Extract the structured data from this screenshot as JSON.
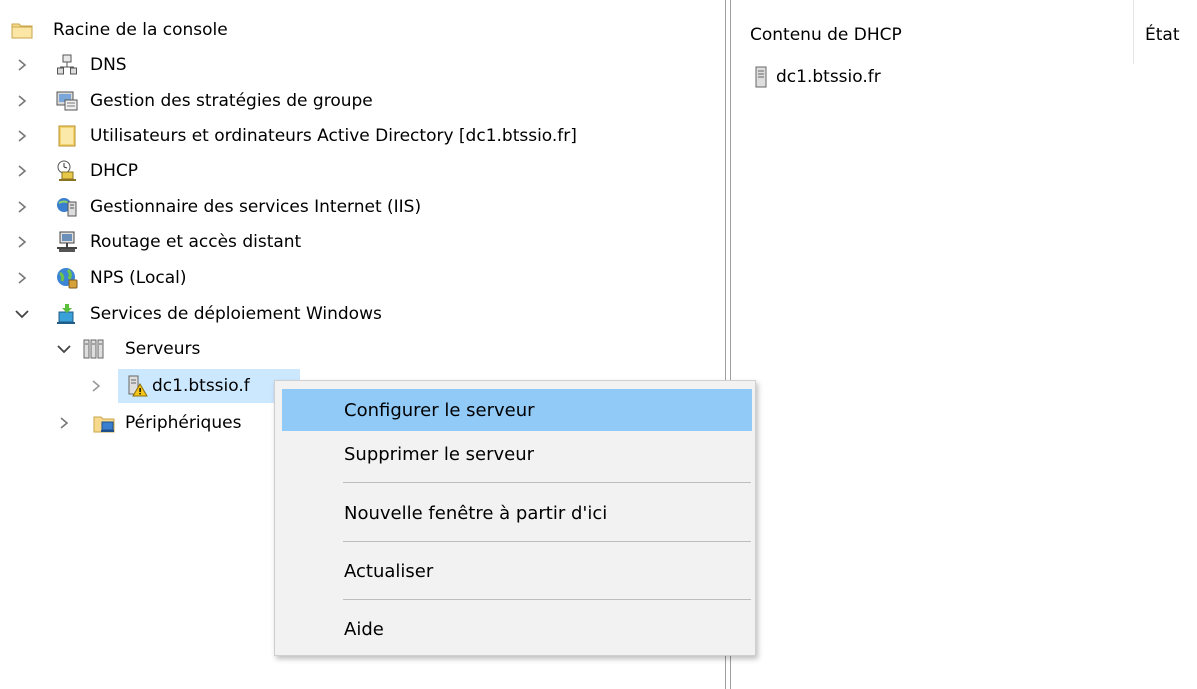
{
  "tree": {
    "root": {
      "label": "Racine de la console",
      "icon": "folder-icon"
    },
    "items": [
      {
        "label": "DNS",
        "icon": "dns-icon",
        "expanded": false
      },
      {
        "label": "Gestion des stratégies de groupe",
        "icon": "gpo-icon",
        "expanded": false
      },
      {
        "label": "Utilisateurs et ordinateurs Active Directory [dc1.btssio.fr]",
        "icon": "ad-icon",
        "expanded": false
      },
      {
        "label": "DHCP",
        "icon": "dhcp-icon",
        "expanded": false
      },
      {
        "label": "Gestionnaire des services Internet (IIS)",
        "icon": "iis-icon",
        "expanded": false
      },
      {
        "label": "Routage et accès distant",
        "icon": "routing-icon",
        "expanded": false
      },
      {
        "label": "NPS (Local)",
        "icon": "nps-icon",
        "expanded": false
      },
      {
        "label": "Services de déploiement Windows",
        "icon": "wds-icon",
        "expanded": true
      }
    ],
    "wds_children": {
      "servers": {
        "label": "Serveurs",
        "icon": "servers-icon",
        "expanded": true
      },
      "server_node": {
        "label": "dc1.btssio.f",
        "icon": "server-warning-icon",
        "selected": true
      },
      "devices": {
        "label": "Périphériques",
        "icon": "devices-icon",
        "expanded": false
      }
    }
  },
  "content": {
    "columns": [
      "Contenu de DHCP",
      "État"
    ],
    "rows": [
      {
        "name": "dc1.btssio.fr",
        "icon": "server-icon"
      }
    ]
  },
  "context_menu": {
    "items": [
      {
        "label": "Configurer le serveur",
        "highlighted": true
      },
      {
        "label": "Supprimer le serveur"
      },
      {
        "label": "Nouvelle fenêtre à partir d'ici"
      },
      {
        "label": "Actualiser"
      },
      {
        "label": "Aide"
      }
    ]
  },
  "colors": {
    "selection": "#cce8ff",
    "menu_highlight": "#91c9f7",
    "menu_background": "#f2f2f2"
  }
}
